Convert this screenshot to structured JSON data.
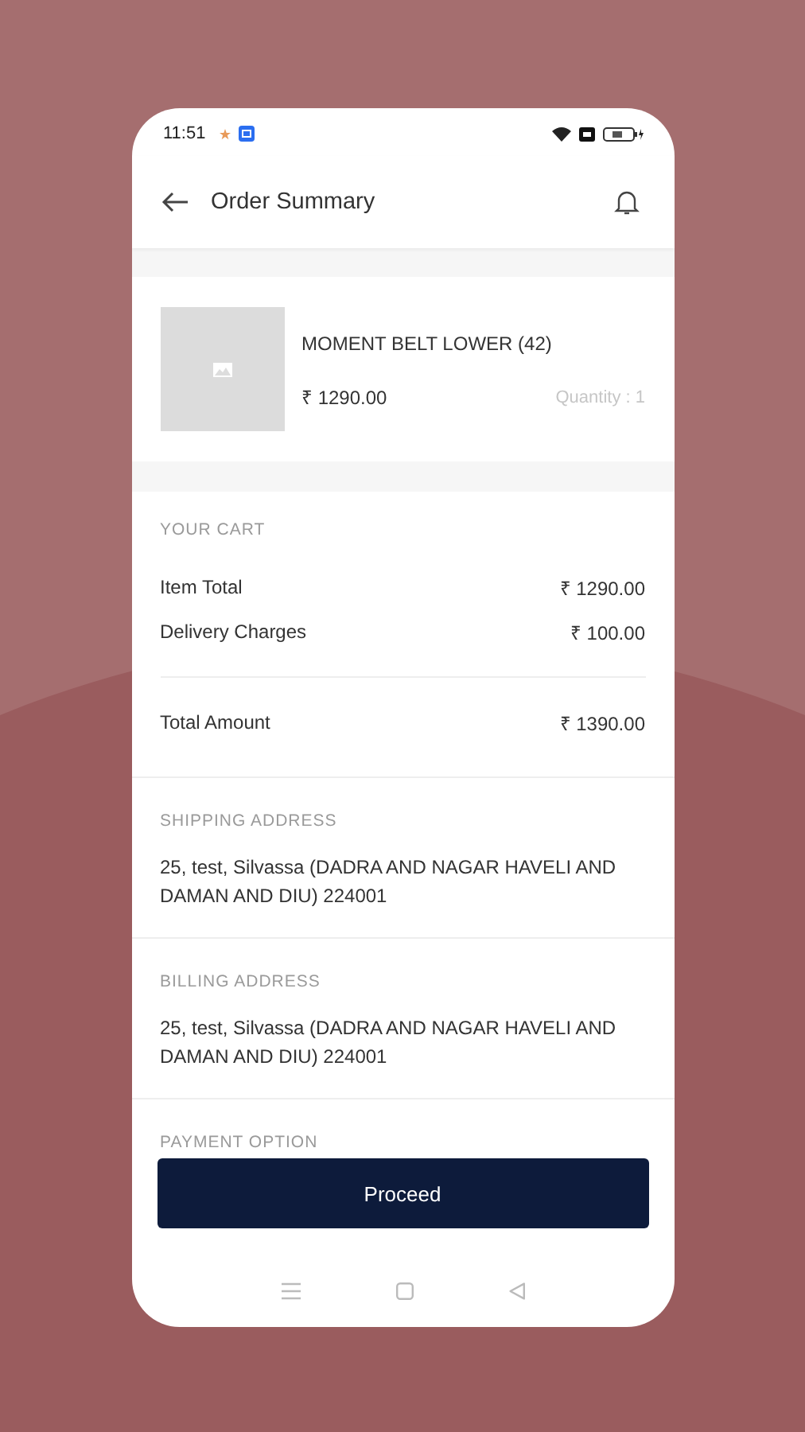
{
  "status_bar": {
    "time": "11:51"
  },
  "header": {
    "title": "Order Summary"
  },
  "product": {
    "name": "MOMENT BELT LOWER (42)",
    "price": "₹ 1290.00",
    "quantity": "Quantity : 1"
  },
  "cart": {
    "heading": "YOUR CART",
    "rows": [
      {
        "label": "Item Total",
        "value": "₹ 1290.00"
      },
      {
        "label": "Delivery Charges",
        "value": "₹ 100.00"
      }
    ],
    "total": {
      "label": "Total Amount",
      "value": "₹ 1390.00"
    }
  },
  "addresses": [
    {
      "heading": "SHIPPING ADDRESS",
      "text": "25, test,  Silvassa (DADRA AND NAGAR HAVELI AND DAMAN AND DIU) 224001"
    },
    {
      "heading": "BILLING ADDRESS",
      "text": "25, test,  Silvassa (DADRA AND NAGAR HAVELI AND DAMAN AND DIU) 224001"
    }
  ],
  "payment": {
    "heading": "PAYMENT OPTION"
  },
  "button": {
    "label": "Proceed"
  }
}
